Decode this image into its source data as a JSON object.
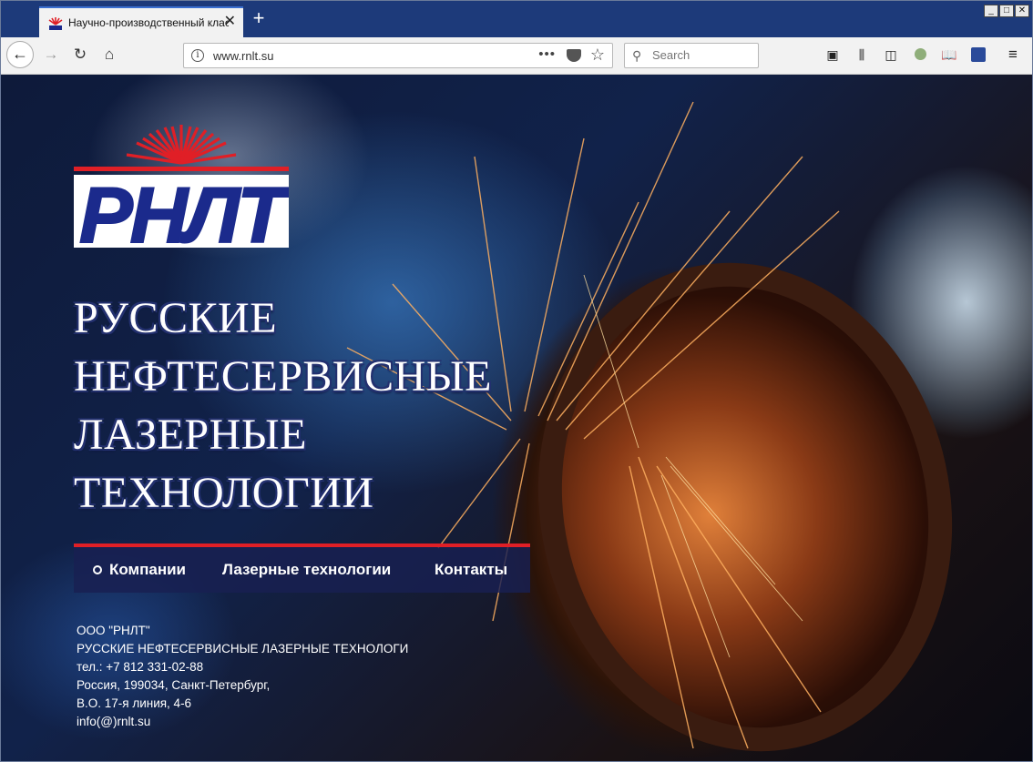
{
  "browser": {
    "tab_title": "Научно-производственный клас",
    "tab_close": "✕",
    "new_tab": "+",
    "url": "www.rnlt.su",
    "page_actions": "•••",
    "search_placeholder": "Search",
    "window_controls": [
      "_",
      "□",
      "✕"
    ]
  },
  "site": {
    "logo_text": "РНЛТ",
    "heading_lines": [
      "РУССКИЕ",
      "НЕФТЕСЕРВИСНЫЕ",
      "ЛАЗЕРНЫЕ",
      "ТЕХНОЛОГИИ"
    ],
    "menu": [
      {
        "label": "Компании",
        "active": true
      },
      {
        "label": "Лазерные технологии"
      },
      {
        "label": "Контакты"
      }
    ],
    "contacts": [
      "ООО \"РНЛТ\"",
      "РУССКИЕ НЕФТЕСЕРВИСНЫЕ ЛАЗЕРНЫЕ ТЕХНОЛОГИ",
      "тел.: +7 812 331-02-88",
      "Россия, 199034, Санкт-Петербург,",
      "В.О. 17-я линия, 4-6",
      "info(@)rnlt.su"
    ]
  },
  "colors": {
    "brand_blue": "#1b2a8c",
    "brand_red": "#e01f26",
    "titlebar": "#1d3a7a"
  },
  "icons": [
    "firefox-favicon-icon",
    "back-arrow-icon",
    "forward-arrow-icon",
    "reload-icon",
    "home-icon",
    "info-icon",
    "pocket-icon",
    "bookmark-star-icon",
    "search-icon",
    "reader-view-icon",
    "library-icon",
    "sidebar-icon",
    "extension-icon",
    "reading-list-icon",
    "stats-icon",
    "hamburger-menu-icon"
  ]
}
